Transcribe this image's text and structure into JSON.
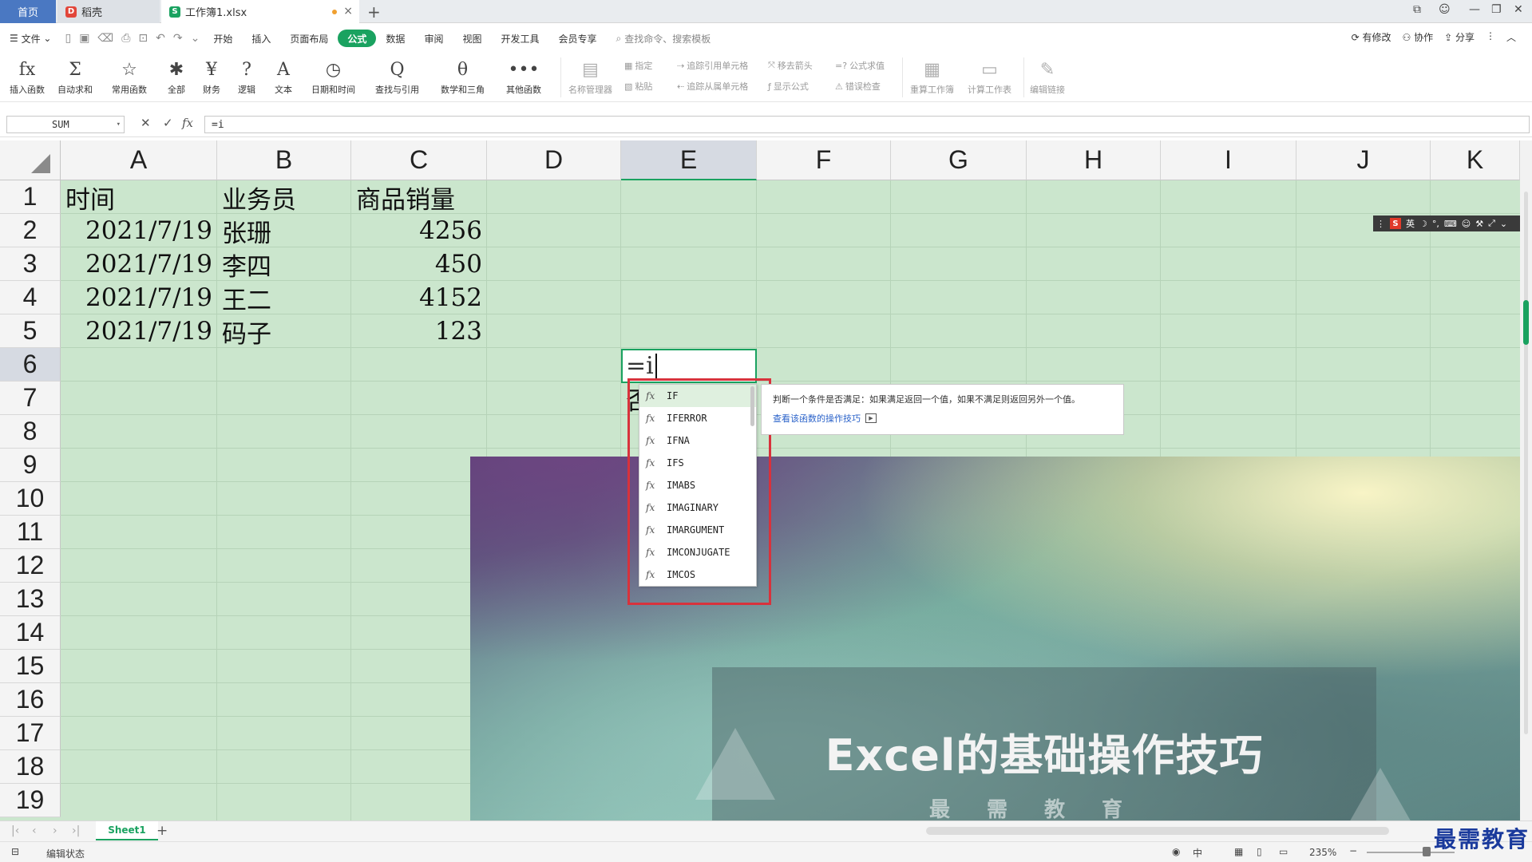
{
  "tabs": {
    "home": "首页",
    "daoke": "稻壳",
    "workbook": "工作簿1.xlsx"
  },
  "menu": {
    "file": "文件",
    "items": [
      "开始",
      "插入",
      "页面布局",
      "公式",
      "数据",
      "审阅",
      "视图",
      "开发工具",
      "会员专享"
    ],
    "active": "公式",
    "search_placeholder": "查找命令、搜索模板",
    "right": [
      "有修改",
      "协作",
      "分享"
    ]
  },
  "ribbon": {
    "main": [
      {
        "label": "插入函数",
        "icon": "fx"
      },
      {
        "label": "自动求和",
        "icon": "Σ"
      },
      {
        "label": "常用函数",
        "icon": "☆"
      },
      {
        "label": "全部",
        "icon": "✱"
      },
      {
        "label": "财务",
        "icon": "¥"
      },
      {
        "label": "逻辑",
        "icon": "?"
      },
      {
        "label": "文本",
        "icon": "A"
      },
      {
        "label": "日期和时间",
        "icon": "◷"
      },
      {
        "label": "查找与引用",
        "icon": "Q"
      },
      {
        "label": "数学和三角",
        "icon": "θ"
      },
      {
        "label": "其他函数",
        "icon": "•••"
      }
    ],
    "names": [
      {
        "label": "名称管理器"
      }
    ],
    "small": [
      "指定",
      "粘贴",
      "追踪引用单元格",
      "追踪从属单元格",
      "移去箭头",
      "显示公式",
      "公式求值",
      "错误检查"
    ],
    "calc": [
      "重算工作簿",
      "计算工作表",
      "编辑链接"
    ]
  },
  "formula_bar": {
    "name_box": "SUM",
    "content": "=i"
  },
  "columns": [
    "A",
    "B",
    "C",
    "D",
    "E",
    "F",
    "G",
    "H",
    "I",
    "J",
    "K"
  ],
  "rows": [
    "1",
    "2",
    "3",
    "4",
    "5",
    "6",
    "7",
    "8",
    "9",
    "10",
    "11",
    "12",
    "13",
    "14",
    "15",
    "16",
    "17",
    "18",
    "19"
  ],
  "table": {
    "header": [
      "时间",
      "业务员",
      "商品销量"
    ],
    "data": [
      [
        "2021/7/19",
        "张珊",
        "4256"
      ],
      [
        "2021/7/19",
        "李四",
        "450"
      ],
      [
        "2021/7/19",
        "王二",
        "4152"
      ],
      [
        "2021/7/19",
        "码子",
        "123"
      ]
    ]
  },
  "active_cell": {
    "value": "=i",
    "below_char": "否"
  },
  "autocomplete": {
    "items": [
      "IF",
      "IFERROR",
      "IFNA",
      "IFS",
      "IMABS",
      "IMAGINARY",
      "IMARGUMENT",
      "IMCONJUGATE",
      "IMCOS"
    ],
    "fx": "fx",
    "tip_text": "判断一个条件是否满足：如果满足返回一个值，如果不满足则返回另外一个值。",
    "tip_link": "查看该函数的操作技巧"
  },
  "banner": {
    "title": "Excel的基础操作技巧",
    "subtitle": "最需教育"
  },
  "ime": {
    "logo": "S",
    "lang": "英"
  },
  "sheets": {
    "active": "Sheet1"
  },
  "status": {
    "mode": "编辑状态",
    "input": "中",
    "zoom": "235%"
  },
  "watermark": "最需教育",
  "colors": {
    "accent": "#1aa260",
    "grid_bg": "#cbe6cd",
    "highlight_frame": "#d8323c"
  }
}
